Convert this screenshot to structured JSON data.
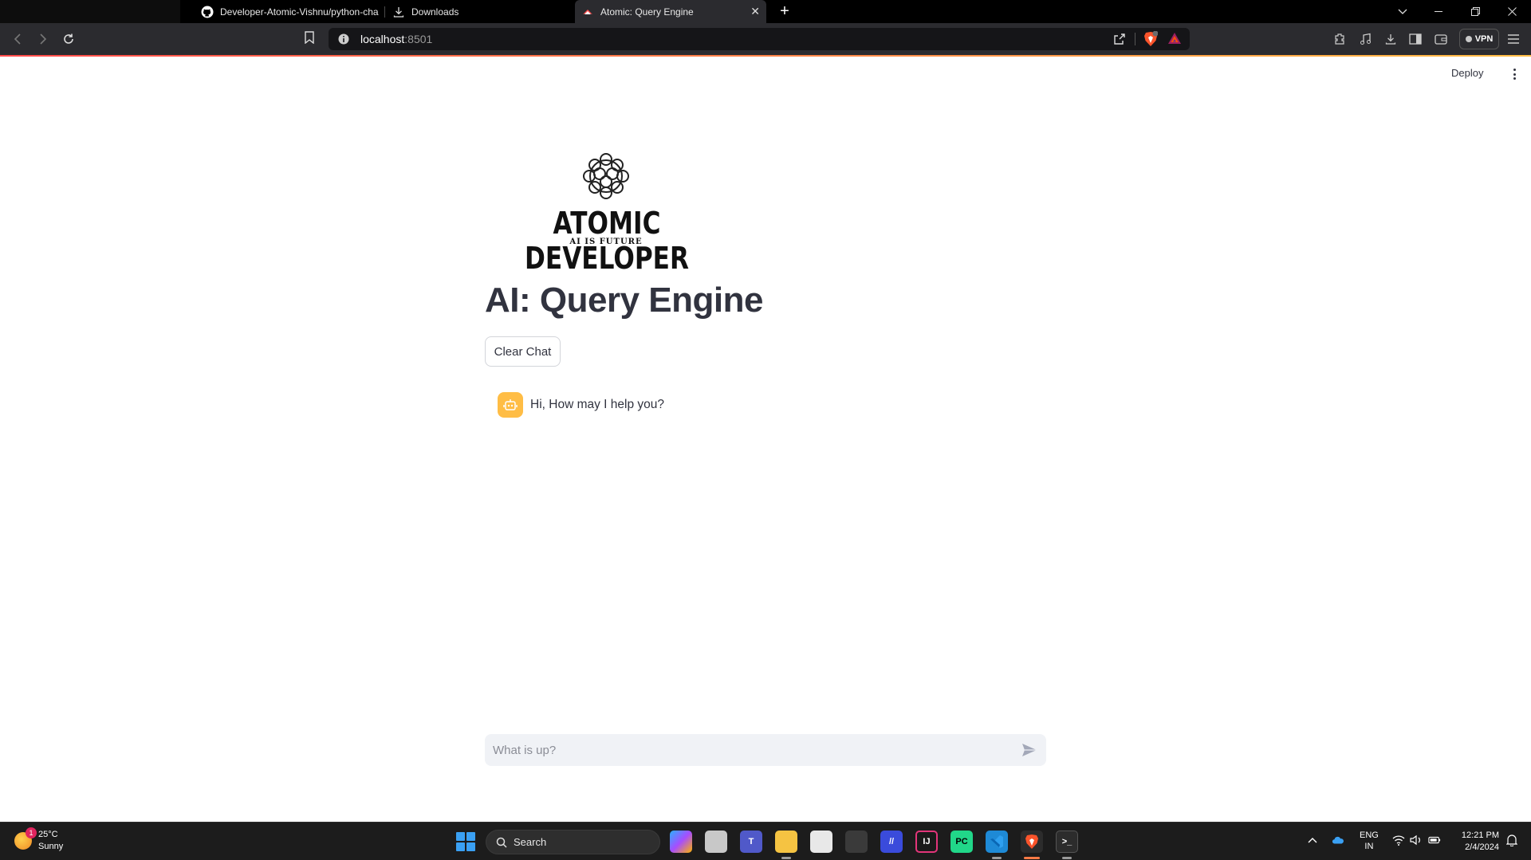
{
  "browser": {
    "tabs": [
      {
        "label": "Developer-Atomic-Vishnu/python-cha",
        "icon": "github-icon"
      },
      {
        "label": "Downloads",
        "icon": "download-icon"
      },
      {
        "label": "Atomic: Query Engine",
        "icon": "streamlit-icon",
        "active": true
      }
    ],
    "url_host": "localhost",
    "url_port": ":8501",
    "vpn_label": "VPN",
    "brave_badge": "1"
  },
  "app": {
    "deploy_label": "Deploy",
    "logo_brand": "ATOMIC DEVELOPER",
    "logo_tagline": "AI IS FUTURE",
    "title": "AI: Query Engine",
    "clear_button": "Clear Chat",
    "messages": [
      {
        "role": "assistant",
        "text": "Hi, How may I help you?"
      }
    ],
    "chat_placeholder": "What is up?",
    "accent_colors": {
      "primary": "#ff4b4b",
      "avatar": "#ffbd45"
    }
  },
  "taskbar": {
    "weather_temp": "25°C",
    "weather_desc": "Sunny",
    "weather_badge": "1",
    "search_label": "Search",
    "lang_top": "ENG",
    "lang_bottom": "IN",
    "time": "12:21 PM",
    "date": "2/4/2024"
  }
}
